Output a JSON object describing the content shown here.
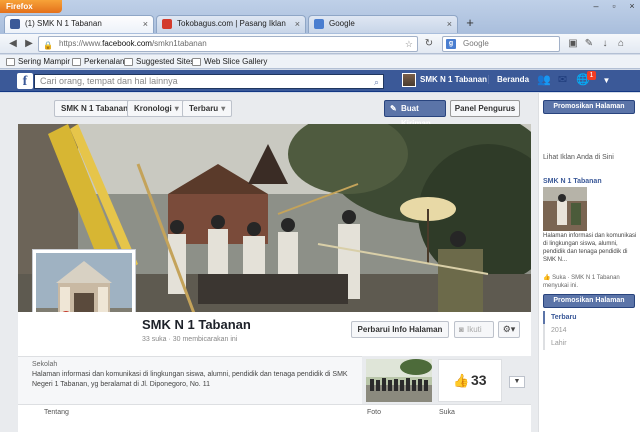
{
  "browser": {
    "app_button": "Firefox",
    "tabs": [
      {
        "title": "(1) SMK N 1 Tabanan",
        "icon": "facebook-icon",
        "color": "#3b5998",
        "active": true
      },
      {
        "title": "Tokobagus.com | Pasang Iklan",
        "icon": "tokobagus-icon",
        "color": "#d33b2c",
        "active": false
      },
      {
        "title": "Google",
        "icon": "google-icon",
        "color": "#4a7ed0",
        "active": false
      }
    ],
    "url_prefix": "https://www.",
    "url_domain": "facebook.com",
    "url_path": "/smkn1tabanan",
    "search_placeholder": "Google",
    "bookmarks": [
      "Sering Mampir",
      "Perkenalan",
      "Suggested Sites",
      "Web Slice Gallery"
    ]
  },
  "facebook": {
    "search_placeholder": "Cari orang, tempat dan hal lainnya",
    "nav_page_name": "SMK N 1 Tabanan",
    "nav_home": "Beranda",
    "notification_count": "1",
    "brand_color": "#3b5998"
  },
  "page": {
    "name_dropdown": "SMK N 1 Tabanan",
    "timeline_dropdown": "Kronologi",
    "recent_dropdown": "Terbaru",
    "create_post": "Buat Kiriman",
    "admin_panel": "Panel Pengurus",
    "title": "SMK N 1 Tabanan",
    "stats": "33 suka · 30 membicarakan ini",
    "update_info": "Perbarui Info Halaman",
    "follow": "Ikuti",
    "category": "Sekolah",
    "about": "Halaman informasi dan komunikasi di lingkungan siswa, alumni, pendidik dan tenaga pendidik di SMK Negeri 1 Tabanan, yg beralamat di Jl. Diponegoro, No. 11",
    "likes_count": "33",
    "tabs": {
      "about": "Tentang",
      "photos": "Foto",
      "likes": "Suka"
    }
  },
  "sidebar": {
    "promote_top": "Promosikan Halaman",
    "ad_heading": "Lihat Iklan Anda di Sini",
    "ad_title": "SMK N 1 Tabanan",
    "ad_text": "Halaman informasi dan komunikasi di lingkungan siswa, alumni, pendidik dan tenaga pendidik di SMK N...",
    "ad_like_line": "Suka · SMK N 1 Tabanan menyukai ini.",
    "promote_bottom": "Promosikan Halaman",
    "years": [
      "Terbaru",
      "2014",
      "Lahir"
    ]
  }
}
